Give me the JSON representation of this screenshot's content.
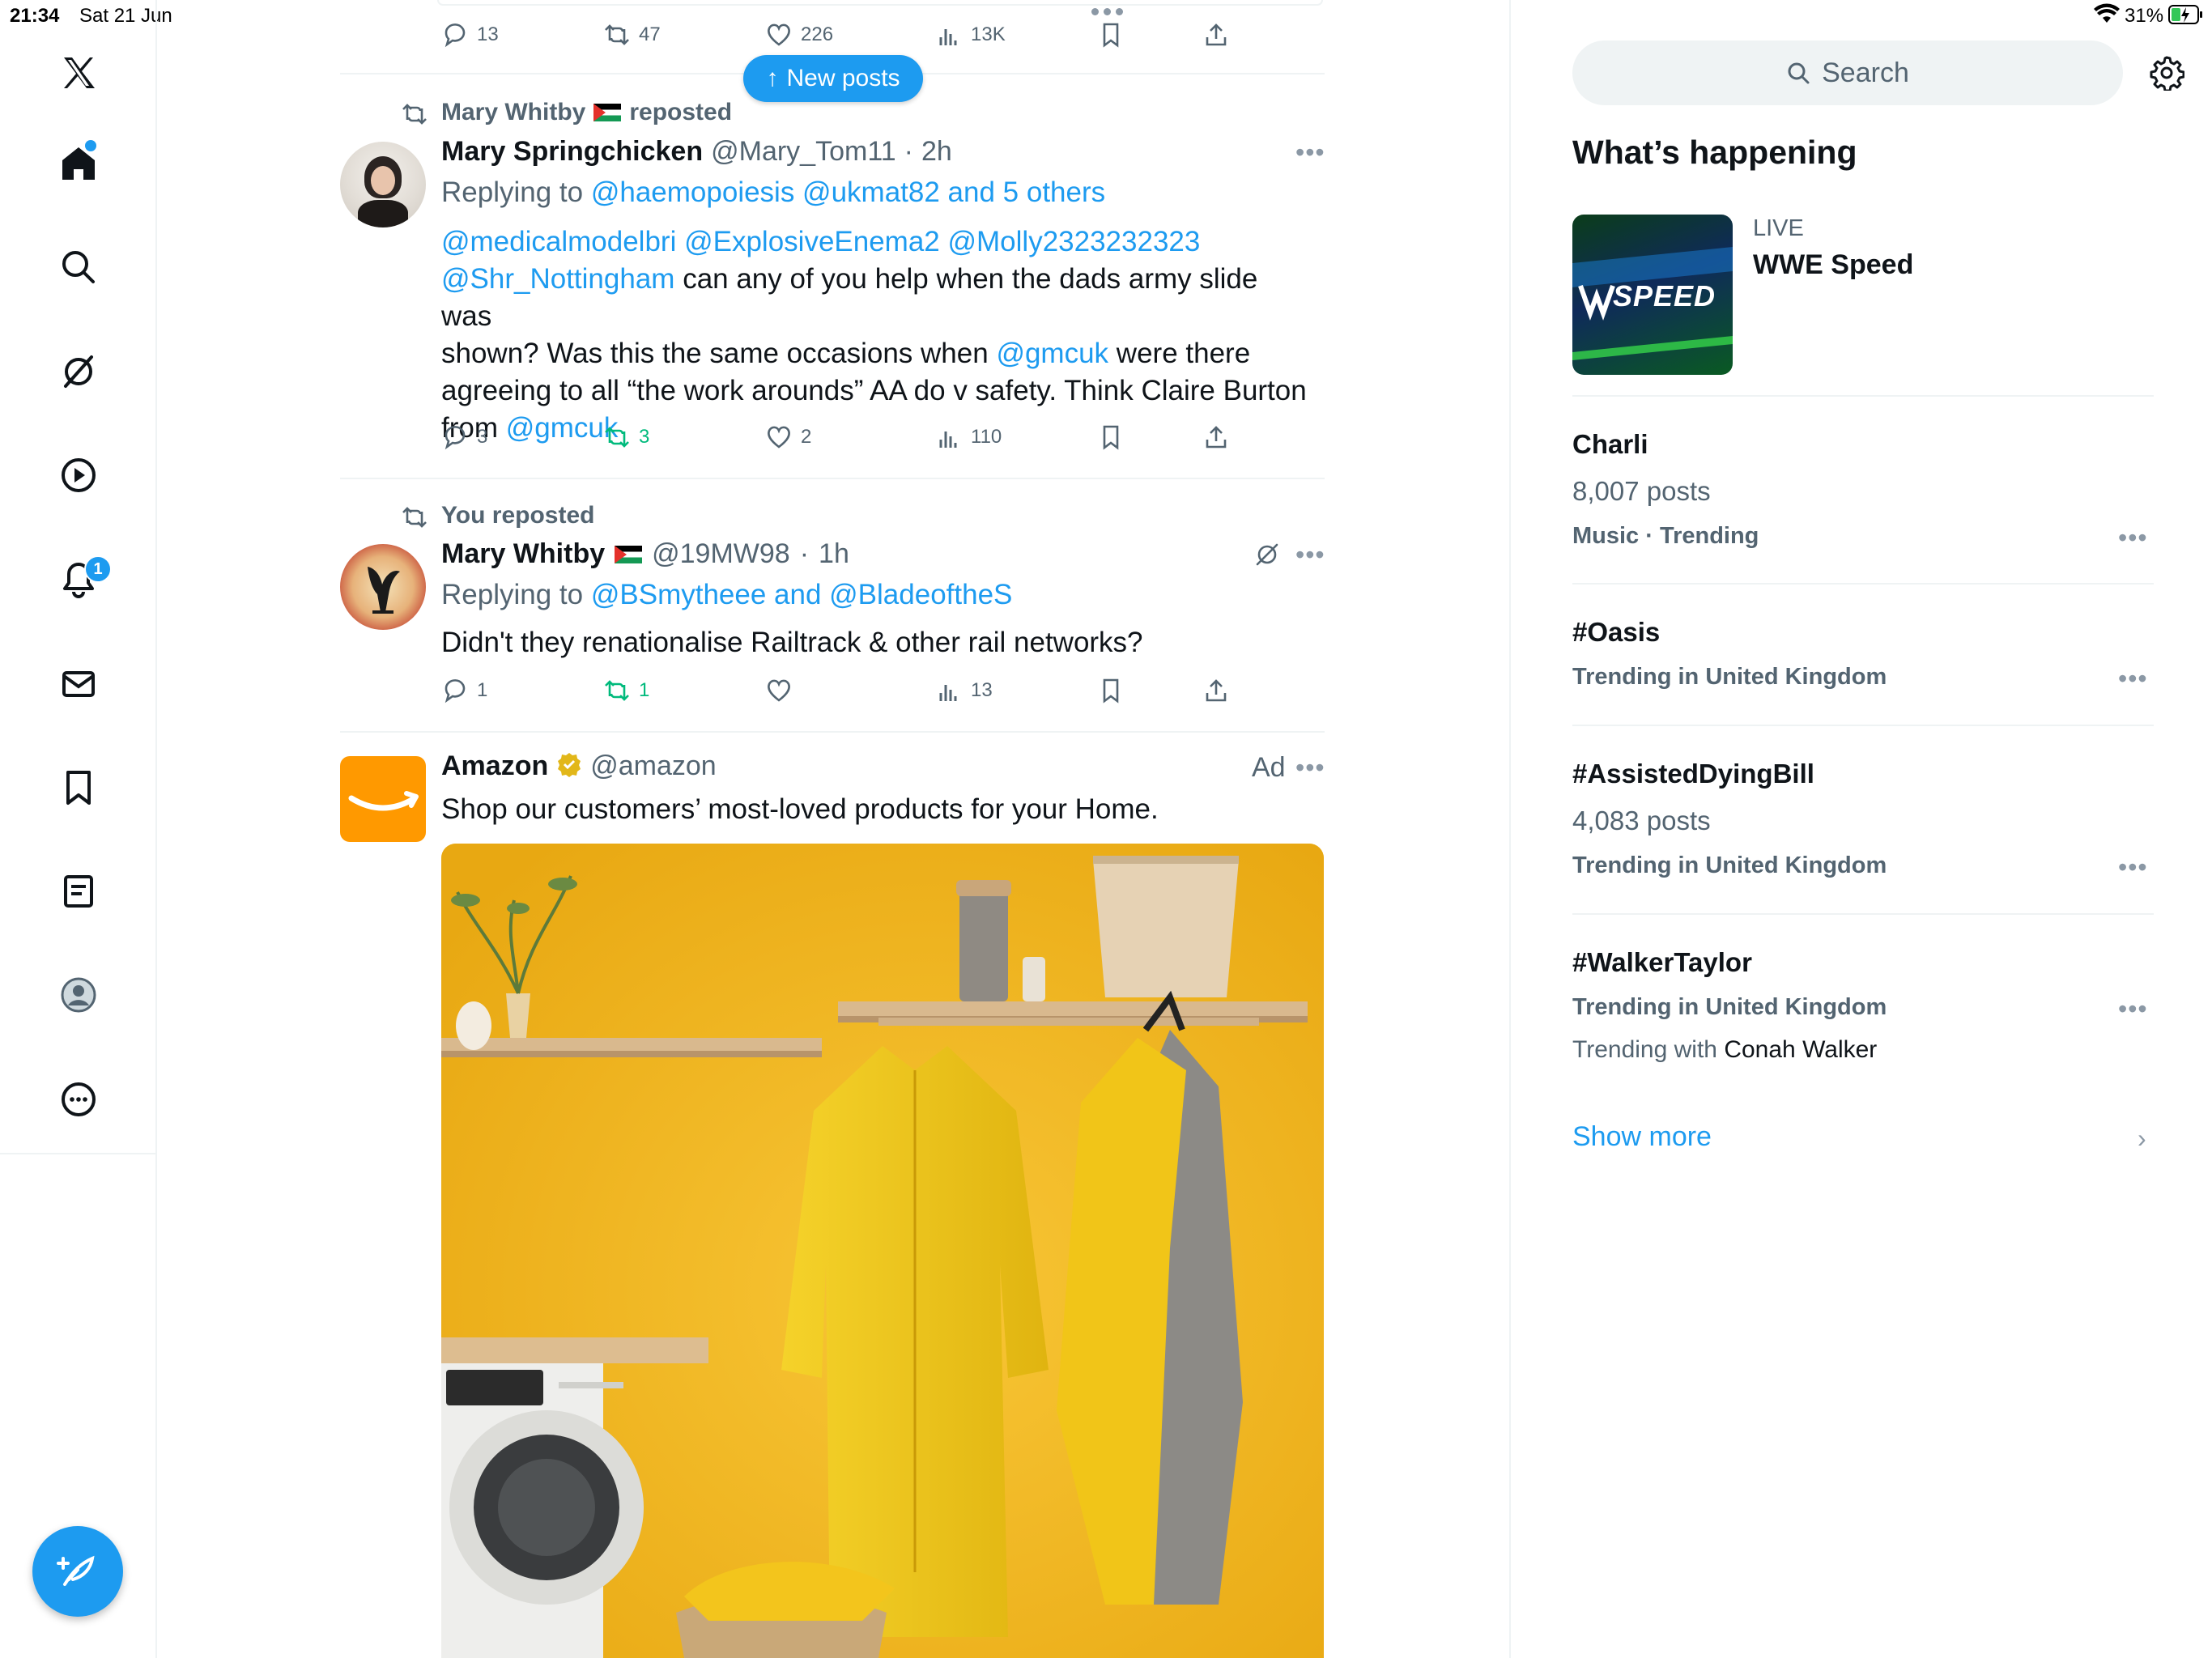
{
  "status_bar": {
    "time": "21:34",
    "date": "Sat 21 Jun",
    "battery": "31%"
  },
  "sidebar": {
    "logo": "x-logo-icon",
    "items": [
      "home-icon",
      "search-icon",
      "grok-icon",
      "video-icon",
      "notifications-icon",
      "messages-icon",
      "bookmarks-icon",
      "lists-icon",
      "profile-icon",
      "more-icon"
    ],
    "notification_badge": "1"
  },
  "new_posts_label": "New posts",
  "top_actions": {
    "replies": "13",
    "reposts": "47",
    "likes": "226",
    "views": "13K"
  },
  "tweets": [
    {
      "social_context": "Mary Whitby",
      "social_context_suffix": "reposted",
      "name": "Mary Springchicken",
      "handle": "@Mary_Tom11",
      "time": "2h",
      "replying_prefix": "Replying to",
      "replying_to": "@haemopoiesis @ukmat82 and 5 others",
      "mentions_line1": "@medicalmodelbri @ExplosiveEnema2 @Molly2323232323",
      "mention_line2": "@Shr_Nottingham",
      "text_line2": "can any of you help when the dads army slide was",
      "text_line3a": "shown?  Was this the same occasions when",
      "mention_gmcuk_a": "@gmcuk",
      "text_line3b": "were there",
      "text_line4": "agreeing to all “the work arounds” AA do  v safety. Think Claire Burton",
      "text_line5a": "from",
      "mention_gmcuk_b": "@gmcuk",
      "replies": "3",
      "reposts": "3",
      "likes": "2",
      "views": "110"
    },
    {
      "social_context": "You reposted",
      "name": "Mary Whitby",
      "handle": "@19MW98",
      "time": "1h",
      "replying_prefix": "Replying to",
      "replying_to": "@BSmytheee and @BladeoftheS",
      "text": "Didn't they renationalise Railtrack & other rail networks?",
      "replies": "1",
      "reposts": "1",
      "likes": "",
      "views": "13"
    },
    {
      "name": "Amazon",
      "handle": "@amazon",
      "ad_label": "Ad",
      "text": "Shop our customers’ most-loved products for your Home."
    }
  ],
  "right": {
    "search_placeholder": "Search",
    "section_title": "What’s happening",
    "live": {
      "label": "LIVE",
      "title": "WWE Speed",
      "thumb_text": "SPEED"
    },
    "trends": [
      {
        "title": "Charli",
        "count": "8,007 posts",
        "meta": "Music · Trending"
      },
      {
        "title": "#Oasis",
        "meta": "Trending in United Kingdom"
      },
      {
        "title": "#AssistedDyingBill",
        "count": "4,083 posts",
        "meta": "Trending in United Kingdom"
      },
      {
        "title": "#WalkerTaylor",
        "meta": "Trending in United Kingdom",
        "with_prefix": "Trending with",
        "with_name": "Conah Walker"
      }
    ],
    "show_more": "Show more"
  },
  "colors": {
    "accent": "#1d9bf0",
    "repost_green": "#00ba7c",
    "amazon_orange": "#ff9900",
    "ad_wall": "#f2b61f"
  }
}
